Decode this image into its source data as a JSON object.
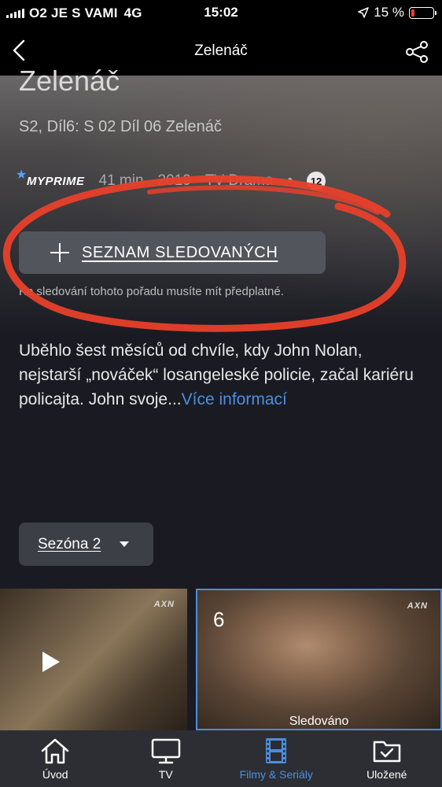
{
  "status_bar": {
    "carrier": "O2 JE S VAMI",
    "network": "4G",
    "time": "15:02",
    "battery": "15 %"
  },
  "header": {
    "title": "Zelenáč"
  },
  "show": {
    "title": "Zelenáč",
    "episode_line": "S2, Díl6: S 02 Díl 06 Zelenáč",
    "logo": "MYPRIME",
    "duration": "41 min",
    "year": "2019",
    "genre": "TV Drama",
    "separator": "•",
    "age_rating": "12"
  },
  "watchlist_button": {
    "label": "SEZNAM SLEDOVANÝCH"
  },
  "subscription_note": "Ke sledování tohoto pořadu musíte mít předplatné.",
  "description": {
    "text": "Uběhlo šest měsíců od chvíle, kdy John Nolan, nejstarší „nováček“ losangeleské policie, začal kariéru policajta. John svoje...",
    "more_link": "Více informací"
  },
  "season_selector": {
    "label": "Sezóna 2"
  },
  "episodes": [
    {
      "channel": "AXN"
    },
    {
      "number": "6",
      "channel": "AXN",
      "status": "Sledováno"
    }
  ],
  "bottom_nav": {
    "items": [
      {
        "label": "Úvod",
        "icon": "home-icon"
      },
      {
        "label": "TV",
        "icon": "tv-icon"
      },
      {
        "label": "Filmy & Seriály",
        "icon": "film-icon"
      },
      {
        "label": "Uložené",
        "icon": "saved-folder-icon"
      }
    ],
    "active_index": 2
  },
  "colors": {
    "accent": "#4a8fe0",
    "annotation": "#e8402a"
  }
}
